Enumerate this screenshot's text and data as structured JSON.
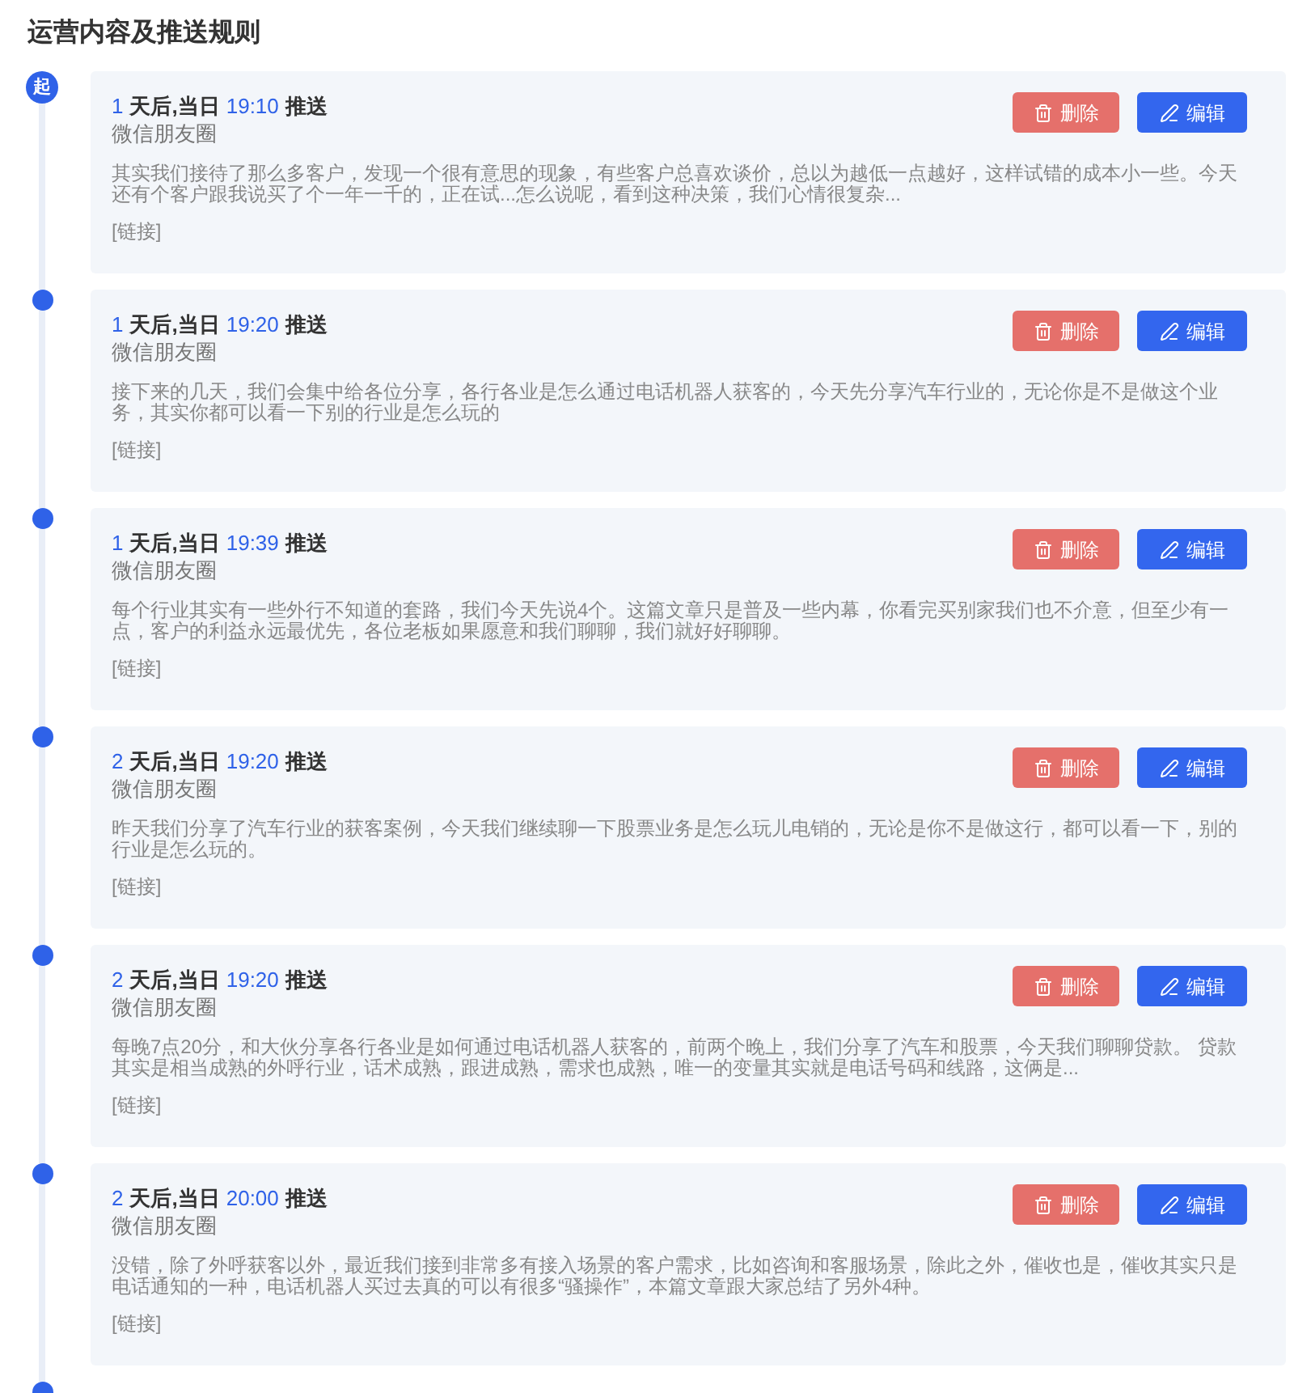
{
  "title": "运营内容及推送规则",
  "timeline": {
    "start_label": "起",
    "items": [
      {
        "days": "1",
        "day_label": "天后,当日",
        "time": "19:10",
        "action": "推送",
        "channel": "微信朋友圈",
        "content": "其实我们接待了那么多客户，发现一个很有意思的现象，有些客户总喜欢谈价，总以为越低一点越好，这样试错的成本小一些。今天还有个客户跟我说买了个一年一千的，正在试...怎么说呢，看到这种决策，我们心情很复杂...",
        "link": "[链接]",
        "delete_label": "删除",
        "edit_label": "编辑"
      },
      {
        "days": "1",
        "day_label": "天后,当日",
        "time": "19:20",
        "action": "推送",
        "channel": "微信朋友圈",
        "content": "接下来的几天，我们会集中给各位分享，各行各业是怎么通过电话机器人获客的，今天先分享汽车行业的，无论你是不是做这个业务，其实你都可以看一下别的行业是怎么玩的",
        "link": "[链接]",
        "delete_label": "删除",
        "edit_label": "编辑"
      },
      {
        "days": "1",
        "day_label": "天后,当日",
        "time": "19:39",
        "action": "推送",
        "channel": "微信朋友圈",
        "content": "每个行业其实有一些外行不知道的套路，我们今天先说4个。这篇文章只是普及一些内幕，你看完买别家我们也不介意，但至少有一点，客户的利益永远最优先，各位老板如果愿意和我们聊聊，我们就好好聊聊。",
        "link": "[链接]",
        "delete_label": "删除",
        "edit_label": "编辑"
      },
      {
        "days": "2",
        "day_label": "天后,当日",
        "time": "19:20",
        "action": "推送",
        "channel": "微信朋友圈",
        "content": "昨天我们分享了汽车行业的获客案例，今天我们继续聊一下股票业务是怎么玩儿电销的，无论是你不是做这行，都可以看一下，别的行业是怎么玩的。",
        "link": "[链接]",
        "delete_label": "删除",
        "edit_label": "编辑"
      },
      {
        "days": "2",
        "day_label": "天后,当日",
        "time": "19:20",
        "action": "推送",
        "channel": "微信朋友圈",
        "content": "每晚7点20分，和大伙分享各行各业是如何通过电话机器人获客的，前两个晚上，我们分享了汽车和股票，今天我们聊聊贷款。 贷款其实是相当成熟的外呼行业，话术成熟，跟进成熟，需求也成熟，唯一的变量其实就是电话号码和线路，这俩是...",
        "link": "[链接]",
        "delete_label": "删除",
        "edit_label": "编辑"
      },
      {
        "days": "2",
        "day_label": "天后,当日",
        "time": "20:00",
        "action": "推送",
        "channel": "微信朋友圈",
        "content": "没错，除了外呼获客以外，最近我们接到非常多有接入场景的客户需求，比如咨询和客服场景，除此之外，催收也是，催收其实只是电话通知的一种，电话机器人买过去真的可以有很多“骚操作”，本篇文章跟大家总结了另外4种。",
        "link": "[链接]",
        "delete_label": "删除",
        "edit_label": "编辑"
      }
    ]
  }
}
